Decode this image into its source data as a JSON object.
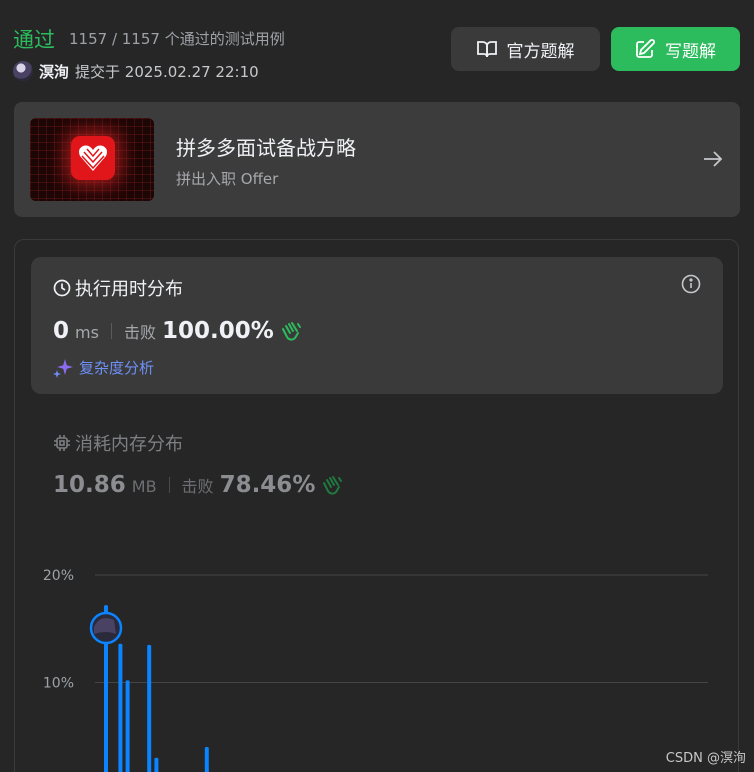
{
  "header": {
    "status": "通过",
    "cases_text": "1157 / 1157 个通过的测试用例",
    "username": "溟洵",
    "submitted_text": "提交于 2025.02.27 22:10",
    "official_solution_label": "官方题解",
    "write_solution_label": "写题解"
  },
  "promo": {
    "title": "拼多多面试备战方略",
    "subtitle": "拼出入职 Offer"
  },
  "runtime": {
    "title": "执行用时分布",
    "value": "0",
    "unit": "ms",
    "beats_label": "击败",
    "beats_value": "100.00%",
    "analysis_label": "复杂度分析"
  },
  "memory": {
    "title": "消耗内存分布",
    "value": "10.86",
    "unit": "MB",
    "beats_label": "击败",
    "beats_value": "78.46%"
  },
  "colors": {
    "accent_green": "#2cbb5d",
    "bar_blue": "#0a84ff",
    "analysis_blue": "#6e8ff5"
  },
  "chart_data": {
    "type": "bar",
    "ylabel": "",
    "xlabel": "",
    "ylim": [
      0,
      20
    ],
    "y_ticks": [
      "20%",
      "10%"
    ],
    "y_tick_values": [
      20,
      10
    ],
    "grid": true,
    "values": [
      17.2,
      0.5,
      13.6,
      10.2,
      0,
      0,
      13.5,
      3.0,
      0,
      0,
      0,
      0,
      0,
      0,
      4.0
    ],
    "marker_index": 0
  },
  "watermark": "CSDN @溟洵"
}
